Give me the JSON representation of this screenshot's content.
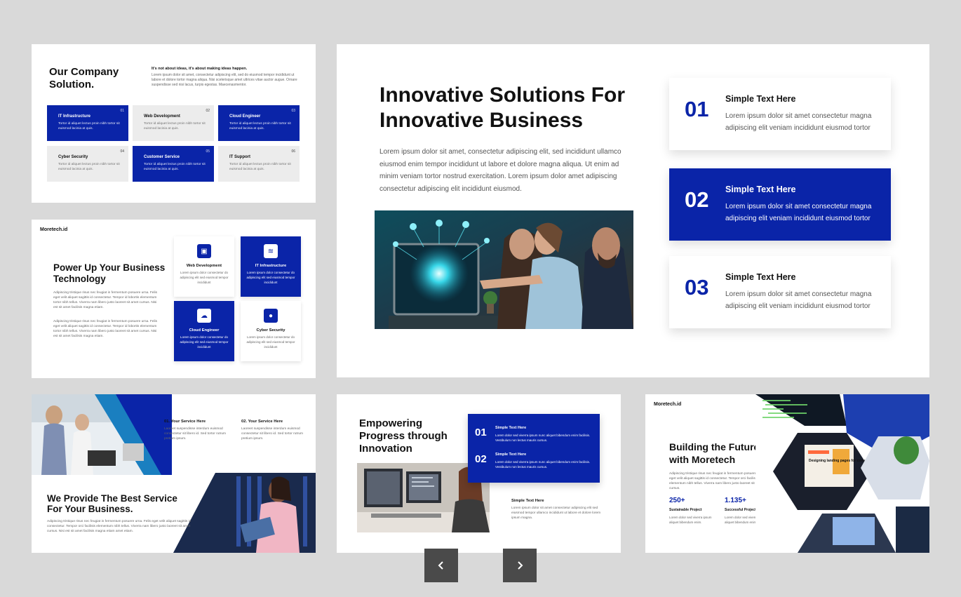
{
  "slide1": {
    "title": "Our Company Solution.",
    "tagline": "It's not about ideas, it's about making ideas happen.",
    "paragraph": "Lorem ipsum dolor sit amet, consectetur adipiscing elit, sed do eiusmod tempor incididunt ut labore et dolore tortor magna aliqua. Nisi scelerisque amet ultrices vitae auctor augue. Ornare suspendisse sed nisi lacus, turpis egestas. Maecenasmentor.",
    "tiles": [
      {
        "number": "01",
        "title": "IT Infrastructure",
        "desc": "Tortor id aliquet lectus proin nibh tortor sit euismod lacinia at quis."
      },
      {
        "number": "02",
        "title": "Web Development",
        "desc": "Tortor id aliquet lectus proin nibh tortor sit euismod lacinia at quis."
      },
      {
        "number": "03",
        "title": "Cloud Engineer",
        "desc": "Tortor id aliquet lectus proin nibh tortor sit euismod lacinia at quis."
      },
      {
        "number": "04",
        "title": "Cyber Security",
        "desc": "Tortor id aliquet lectus proin nibh tortor sit euismod lacinia at quis."
      },
      {
        "number": "05",
        "title": "Customer Service",
        "desc": "Tortor id aliquet lectus proin nibh tortor sit euismod lacinia at quis."
      },
      {
        "number": "06",
        "title": "IT Support",
        "desc": "Tortor id aliquet lectus proin nibh tortor sit euismod lacinia at quis."
      }
    ]
  },
  "slide2": {
    "title": "Innovative Solutions For Innovative Business",
    "paragraph": "Lorem ipsum dolor sit amet, consectetur adipiscing elit, sed incididunt ullamco eiusmod enim tempor incididunt ut labore et dolore magna aliqua. Ut enim ad minim veniam tortor nostrud exercitation. Lorem ipsum dolor amet adipiscing consectetur adipiscing elit incididunt eiusmod.",
    "cards": [
      {
        "number": "01",
        "title": "Simple Text Here",
        "desc": "Lorem ipsum dolor sit amet consectetur magna adipiscing elit veniam incididunt eiusmod tortor"
      },
      {
        "number": "02",
        "title": "Simple Text Here",
        "desc": "Lorem ipsum dolor sit amet consectetur magna adipiscing elit veniam incididunt eiusmod tortor"
      },
      {
        "number": "03",
        "title": "Simple Text Here",
        "desc": "Lorem ipsum dolor sit amet consectetur magna adipiscing elit veniam incididunt eiusmod tortor"
      }
    ]
  },
  "slide3": {
    "brand": "Moretech.id",
    "title": "Power Up Your Business Technology",
    "paragraph1": "Adipiscing tristique risus nec feugiat in fermentum posuere urna. Felis eget velit aliquet sagittis id consectetur. Tempor id lobortis elementum tortor nibh tellus. Viverra nam libero justo laoreet sit amet cursus. Nisi est sit amet facilisis magna etiam.",
    "paragraph2": "Adipiscing tristique risus nec feugiat in fermentum posuere urna. Felis eget velit aliquet sagittis id consectetur. Tempor id lobortis elementum tortor nibh tellus. Viverra nam libero justo laoreet sit amet cursus. Nisi est sit amet facilisis magna etiam.",
    "boxes": [
      {
        "title": "Web Development",
        "desc": "Lorem ipsum dolor consectetur do adipiscing elit sed eiusmod tempor incididunt",
        "icon": "code-window-icon"
      },
      {
        "title": "IT Infrastructure",
        "desc": "Lorem ipsum dolor consectetur do adipiscing elit sed eiusmod tempor incididunt",
        "icon": "router-icon"
      },
      {
        "title": "Cloud Engineer",
        "desc": "Lorem ipsum dolor consectetur do adipiscing elit sed eiusmod tempor incididunt",
        "icon": "cloud-icon"
      },
      {
        "title": "Cyber Security",
        "desc": "Lorem ipsum dolor consectetur do adipiscing elit sed eiusmod tempor incididunt",
        "icon": "lock-icon"
      }
    ]
  },
  "slide4": {
    "service1_title": "01. Your Service Here",
    "service1_desc": "Laoreet suspendisse interdum euismod consectetur sit libero id. Sed tortor rutrum pretium ipsum.",
    "service2_title": "02. Your Service Here",
    "service2_desc": "Laoreet suspendisse interdum euismod consectetur sit libero id. Sed tortor rutrum pretium ipsum.",
    "title": "We Provide The Best Service For Your Business.",
    "paragraph": "Adipiscing tristique risus nec feugiat in fermentum posuere urna. Felis eget velit aliquet sagittis id consectetur. Tempor orci facilisis elementum nibh tellus. Viverra nam libero justo laoreet sit amet cursus. Nisi est sit amet facilisis magna etiam amet etiam."
  },
  "slide5": {
    "title": "Empowering Progress through Innovation",
    "items": [
      {
        "number": "01",
        "title": "Simple Text Here",
        "desc": "Lorem dolor sed viverra ipsum nunc aliquet bibendum enim facilisis. Vestibulum non lectus mauris cursus."
      },
      {
        "number": "02",
        "title": "Simple Text Here",
        "desc": "Lorem dolor sed viverra ipsum nunc aliquet bibendum enim facilisis. Vestibulum non lectus mauris cursus."
      }
    ],
    "side_title": "Simple Text Here",
    "side_desc": "Lorem ipsum dolor sit amet consectetur adipiscing elit sed eiusmod tempor ullamco incididunt ut labore et dolore lorem ipsum magna."
  },
  "slide6": {
    "brand": "Moretech.id",
    "title": "Building the Future with Moretech",
    "paragraph": "Adipiscing tristique risus nec feugiat in fermentum posuere urna. Felis eget velit aliquet sagittis id consectetur. Tempor orci facilisis elementum nibh tellus. Viverra nam libero justo laoreet sit amet cursus.",
    "stats": [
      {
        "value": "250+",
        "label": "Sustainable Project",
        "desc": "Lorem dolor sed viverra ipsum aliquet bibendum enim."
      },
      {
        "value": "1.135+",
        "label": "Successful Project",
        "desc": "Lorem dolor sed viverra ipsum aliquet bibendum enim."
      }
    ],
    "screen_text": "Designing landing pages for conversion"
  },
  "nav": {
    "prev_icon": "chevron-left-icon",
    "next_icon": "chevron-right-icon"
  },
  "colors": {
    "accent": "#0a24a8",
    "background": "#d9d9d9",
    "nav": "#4a4a4a"
  }
}
